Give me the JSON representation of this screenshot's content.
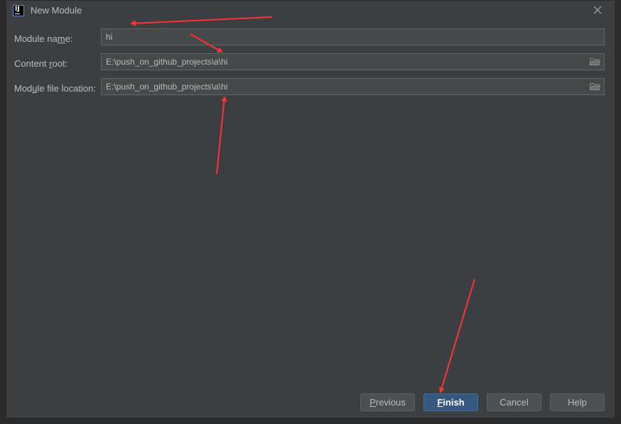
{
  "window": {
    "title": "New Module",
    "app_icon_text": "IJ"
  },
  "form": {
    "module_name": {
      "label_pre": "Module na",
      "label_mn": "m",
      "label_post": "e:",
      "value": "hi"
    },
    "content_root": {
      "label_pre": "Content ",
      "label_mn": "r",
      "label_post": "oot:",
      "value": "E:\\push_on_github_projects\\a\\hi"
    },
    "module_file_location": {
      "label_pre": "Mod",
      "label_mn": "u",
      "label_post": "le file location:",
      "value": "E:\\push_on_github_projects\\a\\hi"
    }
  },
  "buttons": {
    "previous": {
      "mn": "P",
      "rest": "revious"
    },
    "finish": {
      "mn": "F",
      "rest": "inish"
    },
    "cancel": {
      "label": "Cancel"
    },
    "help": {
      "label": "Help"
    }
  },
  "colors": {
    "dialog_bg": "#3c3f41",
    "field_bg": "#45494a",
    "primary_button": "#365880",
    "annotation_arrow": "#ff3333"
  }
}
